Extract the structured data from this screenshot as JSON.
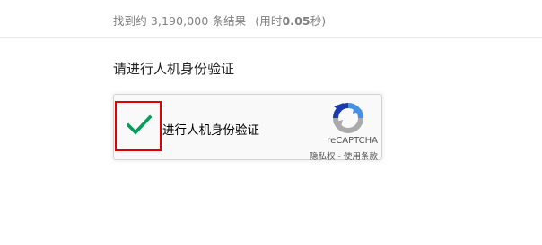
{
  "results": {
    "count_text": "找到约 3,190,000 条结果",
    "time_prefix": "(用时",
    "time_value": "0.05",
    "time_suffix": "秒)"
  },
  "captcha": {
    "heading": "请进行人机身份验证",
    "checkbox_label": "进行人机身份验证",
    "checked": true,
    "brand": "reCAPTCHA",
    "privacy_link": "隐私权",
    "separator": " - ",
    "terms_link": "使用条款"
  },
  "colors": {
    "check_green": "#029f5b",
    "highlight_red": "#e00000",
    "recaptcha_blue": "#4a90e2",
    "recaptcha_light_blue": "#1c3aa9",
    "recaptcha_gray": "#abaaaa"
  },
  "icons": {
    "checkmark": "check-icon",
    "logo": "recaptcha-logo-icon"
  }
}
